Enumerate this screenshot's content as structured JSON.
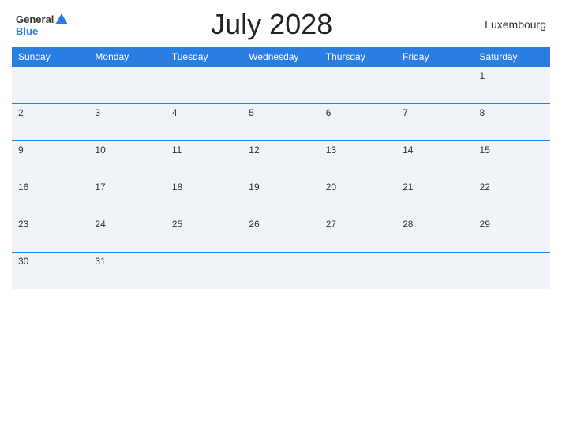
{
  "header": {
    "logo": {
      "general": "General",
      "triangle_alt": "triangle",
      "blue": "Blue"
    },
    "title": "July 2028",
    "country": "Luxembourg"
  },
  "days_of_week": [
    "Sunday",
    "Monday",
    "Tuesday",
    "Wednesday",
    "Thursday",
    "Friday",
    "Saturday"
  ],
  "weeks": [
    [
      "",
      "",
      "",
      "",
      "",
      "",
      "1"
    ],
    [
      "2",
      "3",
      "4",
      "5",
      "6",
      "7",
      "8"
    ],
    [
      "9",
      "10",
      "11",
      "12",
      "13",
      "14",
      "15"
    ],
    [
      "16",
      "17",
      "18",
      "19",
      "20",
      "21",
      "22"
    ],
    [
      "23",
      "24",
      "25",
      "26",
      "27",
      "28",
      "29"
    ],
    [
      "30",
      "31",
      "",
      "",
      "",
      "",
      ""
    ]
  ]
}
